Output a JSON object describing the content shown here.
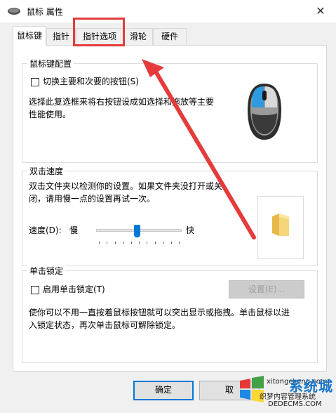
{
  "window": {
    "title": "鼠标 属性",
    "close_glyph": "✕"
  },
  "tabs": [
    {
      "label": "鼠标键",
      "active": true
    },
    {
      "label": "指针"
    },
    {
      "label": "指针选项"
    },
    {
      "label": "滑轮"
    },
    {
      "label": "硬件"
    }
  ],
  "button_config": {
    "title": "鼠标键配置",
    "swap_checkbox_label": "切换主要和次要的按钮(S)",
    "swap_checked": false,
    "description_line1": "选择此复选框来将右按钮设成如选择和拖放等主要",
    "description_line2": "性能使用。"
  },
  "double_click": {
    "title": "双击速度",
    "description_line1": "双击文件夹以检测你的设置。如果文件夹没打开或关",
    "description_line2": "闭，请用慢一点的设置再试一次。",
    "speed_label": "速度(D):",
    "slow_label": "慢",
    "fast_label": "快",
    "speed_level": 0.48
  },
  "click_lock": {
    "title": "单击锁定",
    "enable_checkbox_label": "启用单击锁定(T)",
    "enable_checked": false,
    "settings_button": "设置(E)...",
    "description_line1": "使你可以不用一直按着鼠标按钮就可以突出显示或拖拽。单击鼠标以进",
    "description_line2": "入锁定状态，再次单击鼠标可解除锁定。"
  },
  "footer": {
    "ok_button": "确定",
    "cancel_button": "取"
  },
  "watermark": {
    "site_line1": "xitongcheng.com",
    "logo_text": "系统城",
    "site_line2": "织梦内容管理系统",
    "site_line3": "DEDECMS.COM"
  },
  "colors": {
    "accent": "#0078d7",
    "highlight": "#e53b3b",
    "folder": "#f5d77a"
  },
  "icons": [
    "mouse-icon",
    "folder-icon",
    "mouse-device-icon",
    "close-icon",
    "windows-logo-icon"
  ]
}
